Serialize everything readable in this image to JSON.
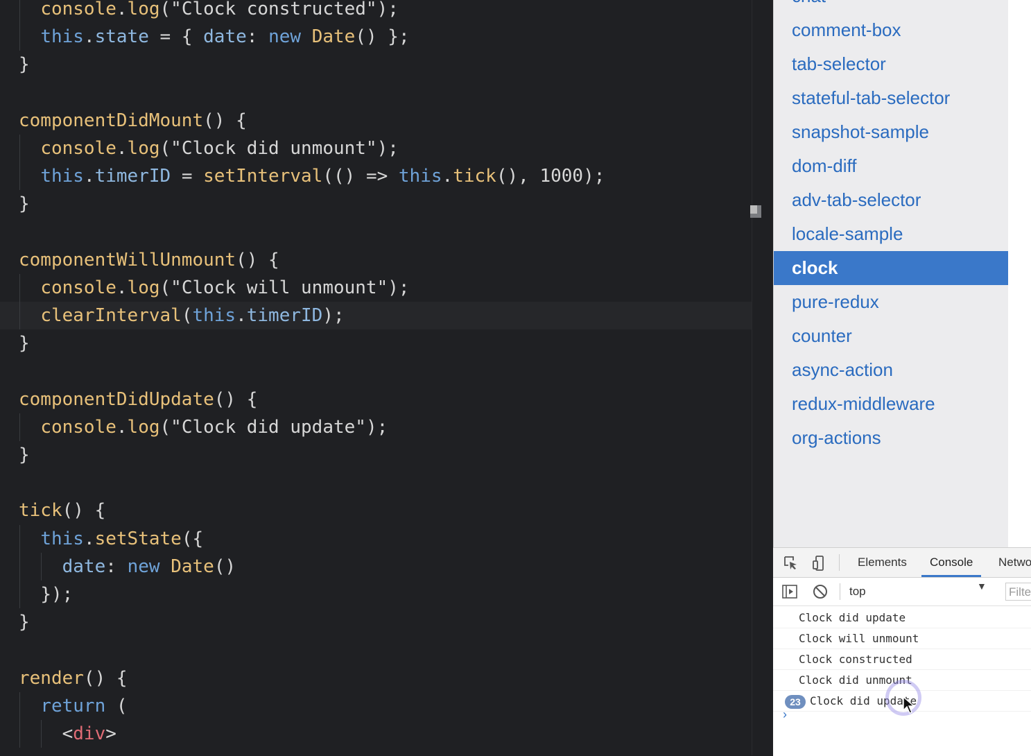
{
  "editor": {
    "lines": [
      [
        [
          "  ",
          "t"
        ],
        [
          "console",
          "cls"
        ],
        [
          ".",
          "p"
        ],
        [
          "log",
          "fn"
        ],
        [
          "(",
          "p"
        ],
        [
          "\"Clock constructed\"",
          "str"
        ],
        [
          ");",
          "p"
        ]
      ],
      [
        [
          "  ",
          "t"
        ],
        [
          "this",
          "kw"
        ],
        [
          ".",
          "p"
        ],
        [
          "state",
          "prop"
        ],
        [
          " = { ",
          "p"
        ],
        [
          "date",
          "prop"
        ],
        [
          ": ",
          "p"
        ],
        [
          "new",
          "kw"
        ],
        [
          " ",
          "t"
        ],
        [
          "Date",
          "cls"
        ],
        [
          "() };",
          "p"
        ]
      ],
      [
        [
          "}",
          "p"
        ]
      ],
      [
        [
          "",
          "t"
        ]
      ],
      [
        [
          "componentDidMount",
          "fn"
        ],
        [
          "() {",
          "p"
        ]
      ],
      [
        [
          "  ",
          "t"
        ],
        [
          "console",
          "cls"
        ],
        [
          ".",
          "p"
        ],
        [
          "log",
          "fn"
        ],
        [
          "(",
          "p"
        ],
        [
          "\"Clock did unmount\"",
          "str"
        ],
        [
          ");",
          "p"
        ]
      ],
      [
        [
          "  ",
          "t"
        ],
        [
          "this",
          "kw"
        ],
        [
          ".",
          "p"
        ],
        [
          "timerID",
          "prop"
        ],
        [
          " = ",
          "p"
        ],
        [
          "setInterval",
          "fn"
        ],
        [
          "(() => ",
          "p"
        ],
        [
          "this",
          "kw"
        ],
        [
          ".",
          "p"
        ],
        [
          "tick",
          "fn"
        ],
        [
          "(), ",
          "p"
        ],
        [
          "1000",
          "num"
        ],
        [
          ");",
          "p"
        ]
      ],
      [
        [
          "}",
          "p"
        ]
      ],
      [
        [
          "",
          "t"
        ]
      ],
      [
        [
          "componentWillUnmount",
          "fn"
        ],
        [
          "() {",
          "p"
        ]
      ],
      [
        [
          "  ",
          "t"
        ],
        [
          "console",
          "cls"
        ],
        [
          ".",
          "p"
        ],
        [
          "log",
          "fn"
        ],
        [
          "(",
          "p"
        ],
        [
          "\"Clock will unmount\"",
          "str"
        ],
        [
          ");",
          "p"
        ]
      ],
      [
        [
          "  ",
          "t"
        ],
        [
          "clearInterval",
          "fn"
        ],
        [
          "(",
          "p"
        ],
        [
          "this",
          "kw"
        ],
        [
          ".",
          "p"
        ],
        [
          "timerID",
          "prop"
        ],
        [
          ");",
          "p"
        ]
      ],
      [
        [
          "}",
          "p"
        ]
      ],
      [
        [
          "",
          "t"
        ]
      ],
      [
        [
          "componentDidUpdate",
          "fn"
        ],
        [
          "() {",
          "p"
        ]
      ],
      [
        [
          "  ",
          "t"
        ],
        [
          "console",
          "cls"
        ],
        [
          ".",
          "p"
        ],
        [
          "log",
          "fn"
        ],
        [
          "(",
          "p"
        ],
        [
          "\"Clock did update\"",
          "str"
        ],
        [
          ");",
          "p"
        ]
      ],
      [
        [
          "}",
          "p"
        ]
      ],
      [
        [
          "",
          "t"
        ]
      ],
      [
        [
          "tick",
          "fn"
        ],
        [
          "() {",
          "p"
        ]
      ],
      [
        [
          "  ",
          "t"
        ],
        [
          "this",
          "kw"
        ],
        [
          ".",
          "p"
        ],
        [
          "setState",
          "fn"
        ],
        [
          "({",
          "p"
        ]
      ],
      [
        [
          "    ",
          "t"
        ],
        [
          "date",
          "prop"
        ],
        [
          ": ",
          "p"
        ],
        [
          "new",
          "kw"
        ],
        [
          " ",
          "t"
        ],
        [
          "Date",
          "cls"
        ],
        [
          "()",
          "p"
        ]
      ],
      [
        [
          "  ",
          "t"
        ],
        [
          "});",
          "p"
        ]
      ],
      [
        [
          "}",
          "p"
        ]
      ],
      [
        [
          "",
          "t"
        ]
      ],
      [
        [
          "render",
          "fn"
        ],
        [
          "() {",
          "p"
        ]
      ],
      [
        [
          "  ",
          "t"
        ],
        [
          "return",
          "kw"
        ],
        [
          " (",
          "p"
        ]
      ],
      [
        [
          "    ",
          "t"
        ],
        [
          "<",
          "p"
        ],
        [
          "div",
          "tag"
        ],
        [
          ">",
          "p"
        ]
      ]
    ],
    "colors": {
      "t": "#d7d7d7",
      "p": "#d7d7d7",
      "cls": "#e8c17a",
      "fn": "#e8c17a",
      "kw": "#6fa3d9",
      "prop": "#8fb8e0",
      "str": "#d7d7d7",
      "num": "#d7d7d7",
      "tag": "#e06c75"
    }
  },
  "sidebar": {
    "items": [
      {
        "label": "chat",
        "active": false
      },
      {
        "label": "comment-box",
        "active": false
      },
      {
        "label": "tab-selector",
        "active": false
      },
      {
        "label": "stateful-tab-selector",
        "active": false
      },
      {
        "label": "snapshot-sample",
        "active": false
      },
      {
        "label": "dom-diff",
        "active": false
      },
      {
        "label": "adv-tab-selector",
        "active": false
      },
      {
        "label": "locale-sample",
        "active": false
      },
      {
        "label": "clock",
        "active": true
      },
      {
        "label": "pure-redux",
        "active": false
      },
      {
        "label": "counter",
        "active": false
      },
      {
        "label": "async-action",
        "active": false
      },
      {
        "label": "redux-middleware",
        "active": false
      },
      {
        "label": "org-actions",
        "active": false
      }
    ]
  },
  "devtools": {
    "tabs": {
      "elements": "Elements",
      "console": "Console",
      "network": "Netwo"
    },
    "context": "top",
    "filter_placeholder": "Filte",
    "logs": [
      {
        "text": "Clock did update",
        "count": ""
      },
      {
        "text": "Clock will unmount",
        "count": ""
      },
      {
        "text": "Clock constructed",
        "count": ""
      },
      {
        "text": "Clock did unmount",
        "count": ""
      },
      {
        "text": "Clock did update",
        "count": "23"
      }
    ],
    "prompt": "›"
  }
}
